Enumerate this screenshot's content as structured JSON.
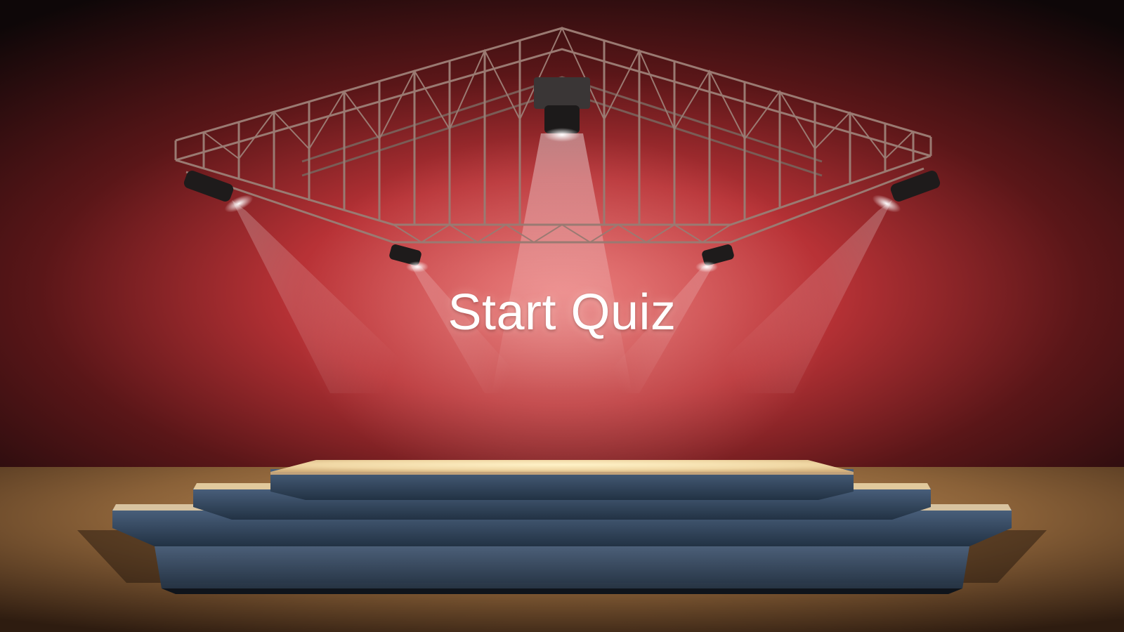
{
  "menu": {
    "start_label": "Start Quiz"
  },
  "scene": {
    "backdrop_color": "#c8393c",
    "floor_color": "#a6784a",
    "stage_step_color": "#34475f",
    "stage_top_color": "#f3dba8",
    "truss_color": "#9a7a72",
    "spotlights": [
      "ceiling-spotlight",
      "left-front-spotlight",
      "left-inner-spotlight",
      "right-inner-spotlight",
      "right-front-spotlight"
    ]
  }
}
